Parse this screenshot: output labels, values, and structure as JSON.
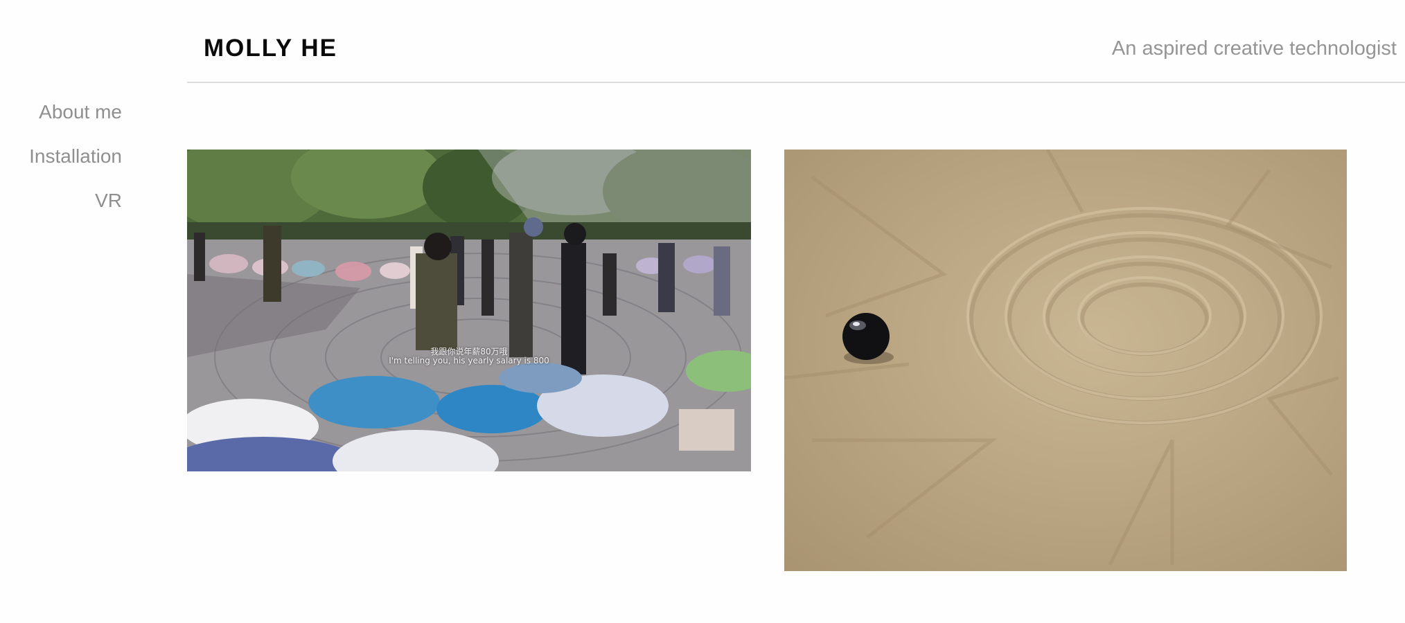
{
  "header": {
    "site_title": "MOLLY HE",
    "tagline": "An aspired creative technologist"
  },
  "nav": {
    "items": [
      {
        "label": "About me"
      },
      {
        "label": "Installation"
      },
      {
        "label": "VR"
      }
    ]
  },
  "gallery": {
    "photos": [
      {
        "subject": "park-crowd-umbrellas",
        "subtitle_zh": "我跟你说年薪80万哦",
        "subtitle_en": "I'm telling you, his yearly salary is 800"
      },
      {
        "subject": "sand-black-ball"
      }
    ]
  },
  "colors": {
    "background": "#fefefe",
    "title": "#0a0a0a",
    "muted_text": "#959595",
    "divider": "#dcdcdc"
  }
}
